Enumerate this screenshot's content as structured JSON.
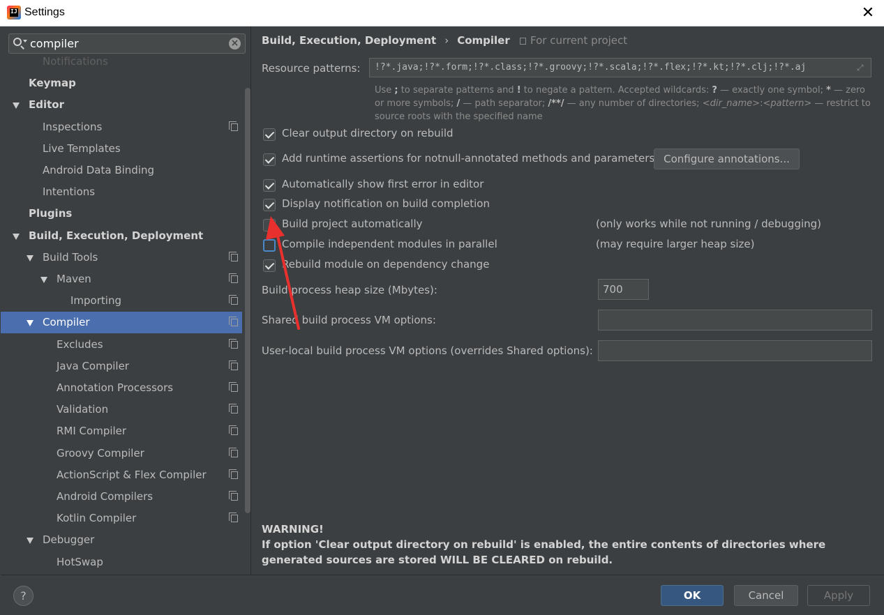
{
  "window": {
    "title": "Settings"
  },
  "search": {
    "value": "compiler",
    "placeholder": ""
  },
  "tree": [
    {
      "label": "Notifications",
      "level": 1,
      "faded": true
    },
    {
      "label": "Keymap",
      "level": 0,
      "bold": true
    },
    {
      "label": "Editor",
      "level": 0,
      "bold": true,
      "expanded": true
    },
    {
      "label": "Inspections",
      "level": 1,
      "copy": true
    },
    {
      "label": "Live Templates",
      "level": 1
    },
    {
      "label": "Android Data Binding",
      "level": 1
    },
    {
      "label": "Intentions",
      "level": 1
    },
    {
      "label": "Plugins",
      "level": 0,
      "bold": true
    },
    {
      "label": "Build, Execution, Deployment",
      "level": 0,
      "bold": true,
      "expanded": true
    },
    {
      "label": "Build Tools",
      "level": 1,
      "expanded": true,
      "copy": true
    },
    {
      "label": "Maven",
      "level": 2,
      "expanded": true,
      "copy": true
    },
    {
      "label": "Importing",
      "level": 3,
      "copy": true
    },
    {
      "label": "Compiler",
      "level": 1,
      "expanded": true,
      "copy": true,
      "selected": true
    },
    {
      "label": "Excludes",
      "level": 2,
      "copy": true
    },
    {
      "label": "Java Compiler",
      "level": 2,
      "copy": true
    },
    {
      "label": "Annotation Processors",
      "level": 2,
      "copy": true
    },
    {
      "label": "Validation",
      "level": 2,
      "copy": true
    },
    {
      "label": "RMI Compiler",
      "level": 2,
      "copy": true
    },
    {
      "label": "Groovy Compiler",
      "level": 2,
      "copy": true
    },
    {
      "label": "ActionScript & Flex Compiler",
      "level": 2,
      "copy": true
    },
    {
      "label": "Android Compilers",
      "level": 2,
      "copy": true
    },
    {
      "label": "Kotlin Compiler",
      "level": 2,
      "copy": true
    },
    {
      "label": "Debugger",
      "level": 1,
      "expanded": true
    },
    {
      "label": "HotSwap",
      "level": 2
    }
  ],
  "breadcrumb": {
    "parent": "Build, Execution, Deployment",
    "sep": "›",
    "current": "Compiler",
    "scope": "For current project"
  },
  "resource_patterns": {
    "label": "Resource patterns:",
    "value": "!?*.java;!?*.form;!?*.class;!?*.groovy;!?*.scala;!?*.flex;!?*.kt;!?*.clj;!?*.aj",
    "hint_1": "Use ",
    "hint_semicolon": ";",
    "hint_2": " to separate patterns and ",
    "hint_bang": "!",
    "hint_3": " to negate a pattern. Accepted wildcards: ",
    "hint_q": "?",
    "hint_4": " — exactly one symbol; ",
    "hint_star": "*",
    "hint_5": " — zero or more symbols; ",
    "hint_slash": "/",
    "hint_6": " — path separator; ",
    "hint_dstar": "/**/",
    "hint_7": " — any number of directories; ",
    "hint_dir": "<dir_name>",
    "hint_colon": ":",
    "hint_pattern": "<pattern>",
    "hint_8": " — restrict to source roots with the specified name"
  },
  "options": {
    "clear_output": {
      "label": "Clear output directory on rebuild",
      "checked": true
    },
    "runtime_assertions": {
      "label": "Add runtime assertions for notnull-annotated methods and parameters",
      "checked": true
    },
    "configure_annotations": "Configure annotations...",
    "show_first_error": {
      "label": "Automatically show first error in editor",
      "checked": true
    },
    "notify_completion": {
      "label": "Display notification on build completion",
      "checked": true
    },
    "build_auto": {
      "label": "Build project automatically",
      "checked": false,
      "note": "(only works while not running / debugging)"
    },
    "compile_parallel": {
      "label": "Compile independent modules in parallel",
      "checked": false,
      "note": "(may require larger heap size)"
    },
    "rebuild_on_change": {
      "label": "Rebuild module on dependency change",
      "checked": true
    }
  },
  "heap": {
    "label": "Build process heap size (Mbytes):",
    "value": "700"
  },
  "shared_vm": {
    "label": "Shared build process VM options:",
    "value": ""
  },
  "user_vm": {
    "label": "User-local build process VM options (overrides Shared options):",
    "value": ""
  },
  "warning": {
    "title": "WARNING!",
    "body": "If option 'Clear output directory on rebuild' is enabled, the entire contents of directories where generated sources are stored WILL BE CLEARED on rebuild."
  },
  "footer": {
    "help": "?",
    "ok": "OK",
    "cancel": "Cancel",
    "apply": "Apply"
  },
  "colors": {
    "selection": "#4b6eaf",
    "annotation_arrow": "#e8302e",
    "primary_button": "#365880"
  }
}
